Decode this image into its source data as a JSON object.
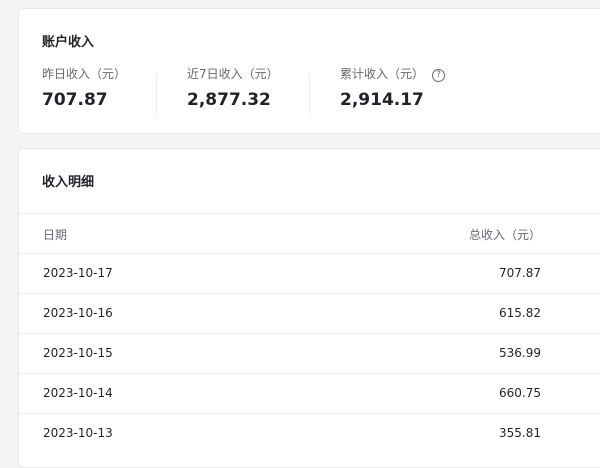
{
  "account": {
    "title": "账户收入",
    "stats": [
      {
        "label": "昨日收入（元）",
        "value": "707.87"
      },
      {
        "label": "近7日收入（元）",
        "value": "2,877.32"
      },
      {
        "label": "累计收入（元）",
        "value": "2,914.17"
      }
    ],
    "help_icon": "question-circle-icon"
  },
  "detail": {
    "title": "收入明细",
    "columns": {
      "date": "日期",
      "amount": "总收入（元）"
    },
    "rows": [
      {
        "date": "2023-10-17",
        "amount": "707.87"
      },
      {
        "date": "2023-10-16",
        "amount": "615.82"
      },
      {
        "date": "2023-10-15",
        "amount": "536.99"
      },
      {
        "date": "2023-10-14",
        "amount": "660.75"
      },
      {
        "date": "2023-10-13",
        "amount": "355.81"
      }
    ]
  }
}
